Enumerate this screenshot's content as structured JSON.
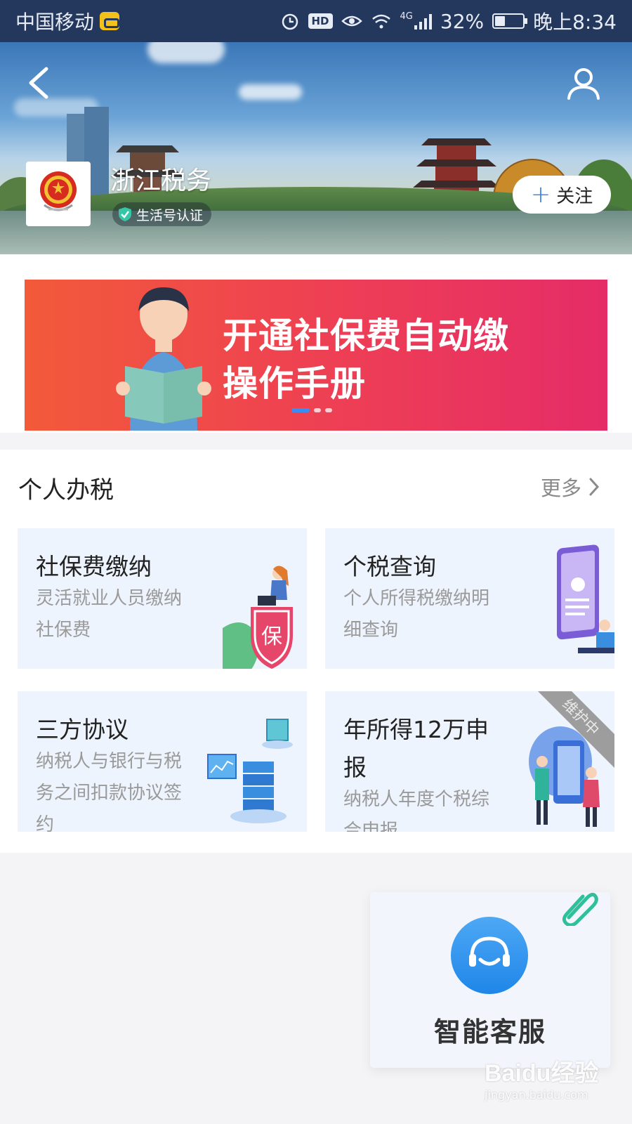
{
  "status_bar": {
    "carrier": "中国移动",
    "hd": "HD",
    "network": "4G",
    "battery": "32%",
    "time": "晚上8:34"
  },
  "header": {
    "account_name": "浙江税务",
    "verify_badge": "生活号认证",
    "follow_label": "关注",
    "icons": [
      "back-arrow-icon",
      "user-icon",
      "emblem-logo",
      "shield-check-icon",
      "plus-icon"
    ]
  },
  "banner": {
    "line1": "开通社保费自动缴",
    "line2": "操作手册",
    "slides": 3,
    "active_slide": 1,
    "colors": {
      "start": "#f25a3a",
      "end": "#e52c67",
      "dot_active": "#3b8cf0"
    }
  },
  "section": {
    "title": "个人办税",
    "more_label": "更多",
    "cards": [
      {
        "title": "社保费缴纳",
        "desc1": "灵活就业人员缴纳",
        "desc2": "社保费",
        "icon": "shield-bao-illustration"
      },
      {
        "title": "个税查询",
        "desc1": "个人所得税缴纳明",
        "desc2": "细查询",
        "icon": "phone-document-illustration"
      },
      {
        "title": "三方协议",
        "desc1": "纳税人与银行与税",
        "desc2": "务之间扣款协议签",
        "desc3": "约",
        "icon": "server-network-illustration"
      },
      {
        "title": "年所得12万申",
        "title2": "报",
        "desc1": "纳税人年度个税综",
        "desc2": "合申报",
        "ribbon": "维护中",
        "icon": "people-phone-illustration"
      }
    ]
  },
  "customer_service": {
    "label": "智能客服",
    "icon": "headset-icon"
  },
  "watermark": {
    "logo": "Baidu经验",
    "url": "jingyan.baidu.com"
  }
}
